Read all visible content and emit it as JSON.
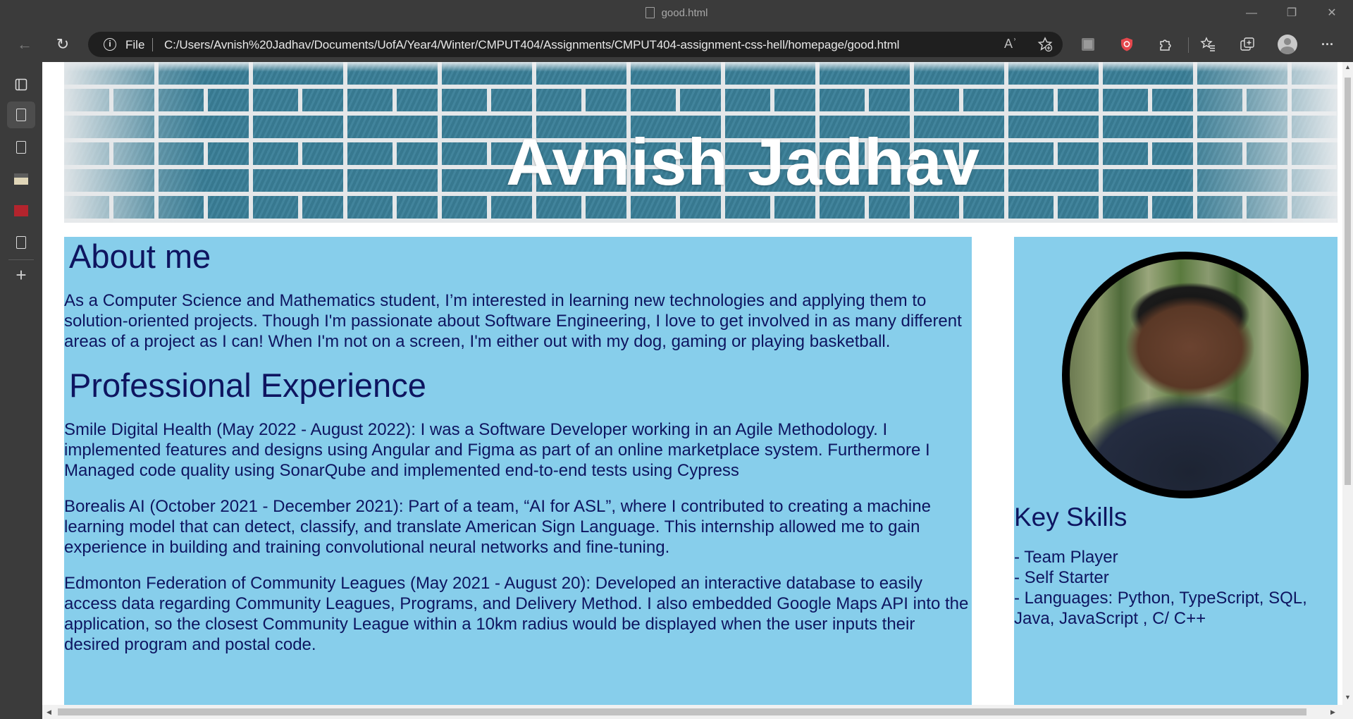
{
  "window": {
    "tab_title": "good.html",
    "minimize_glyph": "—",
    "restore_glyph": "❐",
    "close_glyph": "✕"
  },
  "toolbar": {
    "back_glyph": "←",
    "refresh_glyph": "↻",
    "scheme_label": "File",
    "url": "C:/Users/Avnish%20Jadhav/Documents/UofA/Year4/Winter/CMPUT404/Assignments/CMPUT404-assignment-css-hell/homepage/good.html",
    "read_aloud_glyph": "Aʾ",
    "more_glyph": "···",
    "icons": [
      "read-aloud-icon",
      "add-favorite-icon",
      "extension-box-icon",
      "shield-extension-icon",
      "puzzle-extensions-icon",
      "favorites-icon",
      "collections-icon",
      "profile-avatar-icon",
      "more-options-icon"
    ],
    "colors": {
      "chrome": "#3b3b3b",
      "omnibox": "#1f1f1f",
      "shield_extension": "#e5484d"
    }
  },
  "sidebar": {
    "icons": [
      "tab-actions-icon",
      "page-tab-icon",
      "page-tab-icon",
      "app-tab-icon",
      "app-tab-icon",
      "page-tab-icon"
    ],
    "add_glyph": "+"
  },
  "page": {
    "header_title": "Avnish Jadhav",
    "about_heading": "About me",
    "about_text": "As a Computer Science and Mathematics student, I’m interested in learning new technologies and applying them to solution-oriented projects. Though I'm passionate about Software Engineering, I love to get involved in as many different areas of a project as I can! When I'm not on a screen, I'm either out with my dog, gaming or playing basketball.",
    "experience_heading": "Professional Experience",
    "experience": [
      "Smile Digital Health (May 2022 - August 2022): I was a Software Developer working in an Agile Methodology. I implemented features and designs using Angular and Figma as part of an online marketplace system. Furthermore I Managed code quality using SonarQube and implemented end-to-end tests using Cypress",
      "Borealis AI (October 2021 - December 2021): Part of a team, “AI for ASL”, where I contributed to creating a machine learning model that can detect, classify, and translate American Sign Language. This internship allowed me to gain experience in building and training convolutional neural networks and fine-tuning.",
      "Edmonton Federation of Community Leagues (May 2021 - August 20): Developed an interactive database to easily access data regarding Community Leagues, Programs, and Delivery Method. I also embedded Google Maps API into the application, so the closest Community League within a 10km radius would be displayed when the user inputs their desired program and postal code."
    ],
    "skills_heading": "Key Skills",
    "skills": [
      "- Team Player",
      "- Self Starter",
      "- Languages: Python, TypeScript, SQL, Java, JavaScript , C/ C++"
    ],
    "colors": {
      "panel": "#87ceeb",
      "text": "#0e1560",
      "photo_border": "#000000"
    }
  }
}
